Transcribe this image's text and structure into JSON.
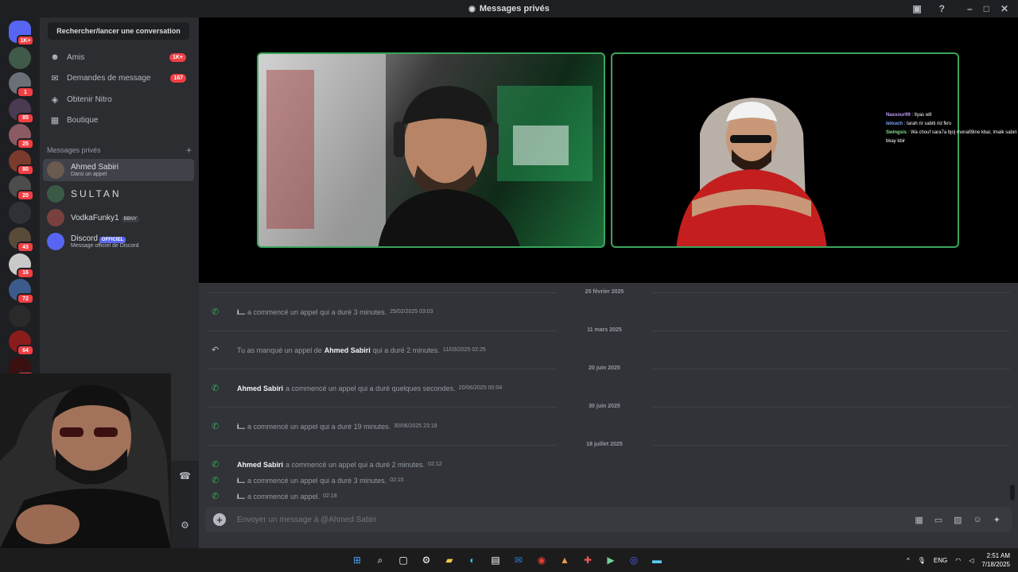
{
  "window": {
    "title": "Messages privés"
  },
  "servers": [
    {
      "badge": "1K+",
      "color": "#5865f2"
    },
    {
      "badge": "",
      "color": "#3f5a48"
    },
    {
      "badge": "1",
      "color": "#6b6f78"
    },
    {
      "badge": "85",
      "color": "#4a3a52"
    },
    {
      "badge": "25",
      "color": "#8a5b63"
    },
    {
      "badge": "80",
      "color": "#7a3b2d"
    },
    {
      "badge": "20",
      "color": "#4c4c4c"
    },
    {
      "badge": "",
      "color": "#2f3136"
    },
    {
      "badge": "43",
      "color": "#5a4a3a"
    },
    {
      "badge": "16",
      "color": "#c9c9c9"
    },
    {
      "badge": "72",
      "color": "#3d5b8a"
    },
    {
      "badge": "",
      "color": "#2a2a2a"
    },
    {
      "badge": "64",
      "color": "#8a1c1c"
    },
    {
      "badge": "61",
      "color": "#3a1010"
    },
    {
      "badge": "56",
      "color": "#4a3a2a"
    },
    {
      "badge": "",
      "color": "#2c8a3c"
    }
  ],
  "sidebar": {
    "search_label": "Rechercher/lancer une conversation",
    "nav": [
      {
        "label": "Amis",
        "badge": "1K+",
        "icon": "friends-icon"
      },
      {
        "label": "Demandes de message",
        "badge": "167",
        "icon": "mail-icon"
      },
      {
        "label": "Obtenir Nitro",
        "badge": "",
        "icon": "nitro-icon"
      },
      {
        "label": "Boutique",
        "badge": "",
        "icon": "shop-icon"
      }
    ],
    "dm_section_title": "Messages privés",
    "dms": [
      {
        "name": "Ahmed Sabiri",
        "sub": "Dans un appel",
        "active": true,
        "color": "#6b5a50"
      },
      {
        "name": "SULTAN",
        "sub": "",
        "active": false,
        "color": "#3b5a46"
      },
      {
        "name": "VodkaFunky1",
        "sub": "",
        "tag": "BBNY",
        "active": false,
        "color": "#7a4040"
      },
      {
        "name": "Discord",
        "sub": "Message officiel de Discord",
        "official": "OFFICIEL",
        "active": false,
        "color": "#5865f2"
      }
    ]
  },
  "overlay_chat": [
    {
      "user": "Nassour99",
      "text": " : Ilyas w9"
    },
    {
      "user": "lelouch",
      "text": " : tarah rir sabiti rid fkro"
    },
    {
      "user": "Swingsis",
      "text": " : Wa chouf sara7a bjoj monafi9ine kbar, lmalk sabiri bkay kbir"
    }
  ],
  "messages": [
    {
      "type": "date",
      "text": "25 février 2025"
    },
    {
      "type": "call",
      "who": "i...",
      "text": "a commencé un appel qui a duré 3 minutes.",
      "time": "25/02/2025 03:03",
      "missed": false
    },
    {
      "type": "date",
      "text": "11 mars 2025"
    },
    {
      "type": "call",
      "prefix": "Tu as manqué un appel de",
      "who": "Ahmed Sabiri",
      "text": "qui a duré 2 minutes.",
      "time": "11/03/2025 02:25",
      "missed": true
    },
    {
      "type": "date",
      "text": "20 juin 2025"
    },
    {
      "type": "call",
      "who": "Ahmed Sabiri",
      "text": "a commencé un appel qui a duré quelques secondes.",
      "time": "20/06/2025 00:04",
      "missed": false
    },
    {
      "type": "date",
      "text": "30 juin 2025"
    },
    {
      "type": "call",
      "who": "i...",
      "text": "a commencé un appel qui a duré 19 minutes.",
      "time": "30/06/2025 23:19",
      "missed": false
    },
    {
      "type": "date",
      "text": "18 juillet 2025"
    },
    {
      "type": "call",
      "who": "Ahmed Sabiri",
      "text": "a commencé un appel qui a duré 2 minutes.",
      "time": "02:12",
      "missed": false
    },
    {
      "type": "call",
      "who": "i...",
      "text": "a commencé un appel qui a duré 3 minutes.",
      "time": "02:15",
      "missed": false
    },
    {
      "type": "call",
      "who": "i...",
      "text": "a commencé un appel.",
      "time": "02:18",
      "missed": false
    }
  ],
  "composer": {
    "placeholder": "Envoyer un message à @Ahmed Sabiri"
  },
  "taskbar": {
    "lang": "ENG",
    "time": "2:51 AM",
    "date": "7/18/2025"
  }
}
